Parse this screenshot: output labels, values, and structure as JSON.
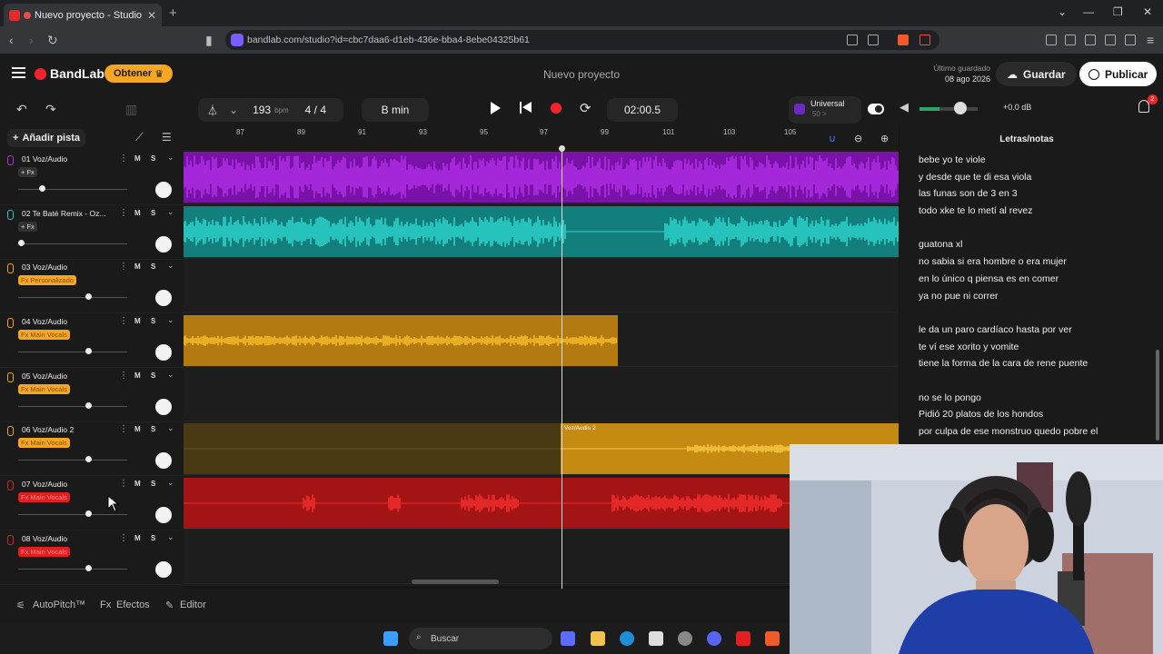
{
  "browser": {
    "tab_title": "Nuevo proyecto - Studio",
    "url": "bandlab.com/studio?id=cbc7daa6-d1eb-436e-bba4-8ebe04325b61"
  },
  "header": {
    "logo": "BandLab",
    "get_label": "Obtener",
    "project_title": "Nuevo proyecto",
    "saved_label": "Último guardado",
    "saved_date": "08 ago 2026",
    "save_label": "Guardar",
    "publish_label": "Publicar"
  },
  "transport": {
    "bpm": "193",
    "bpm_unit": "bpm",
    "time_signature": "4 / 4",
    "key": "B min",
    "time": "02:00.5",
    "preset_name": "Universal",
    "preset_sub": "50 >",
    "volume_db": "+0.0 dB",
    "volume_level": 0.6,
    "notifications": "2"
  },
  "left_panel": {
    "add_track_label": "Añadir pista"
  },
  "tracks": [
    {
      "name": "01 Voz/Audio",
      "fx": "+ Fx",
      "color": "#b32cf0",
      "fx_style": "plain",
      "volume": 0.25
    },
    {
      "name": "02 Te Baté Remix - Oz...",
      "fx": "+ Fx",
      "color": "#26c9c4",
      "fx_style": "plain",
      "volume": 0.0
    },
    {
      "name": "03 Voz/Audio",
      "fx": "Fx Personalizado",
      "color": "#f5a623",
      "fx_style": "tag",
      "volume": 0.8
    },
    {
      "name": "04 Voz/Audio",
      "fx": "Fx Main Vocals",
      "color": "#f5a623",
      "fx_style": "tag",
      "volume": 0.8
    },
    {
      "name": "05 Voz/Audio",
      "fx": "Fx Main Vocals",
      "color": "#f5a623",
      "fx_style": "tag",
      "volume": 0.8
    },
    {
      "name": "06 Voz/Audio 2",
      "fx": "Fx Main Vocals",
      "color": "#f5a623",
      "fx_style": "tag",
      "volume": 0.8
    },
    {
      "name": "07 Voz/Audio",
      "fx": "Fx Main Vocals",
      "color": "#e02020",
      "fx_style": "tag",
      "volume": 0.8
    },
    {
      "name": "08 Voz/Audio",
      "fx": "Fx Main Vocals",
      "color": "#e02020",
      "fx_style": "tag",
      "volume": 0.8
    }
  ],
  "ruler_ticks": [
    "87",
    "89",
    "91",
    "93",
    "95",
    "97",
    "99",
    "101",
    "103",
    "105"
  ],
  "clip_label": "Voz/Audio 2",
  "bottom_tabs": {
    "autopitch": "AutoPitch™",
    "effects": "Efectos",
    "editor": "Editor"
  },
  "lyrics": {
    "title": "Letras/notas",
    "lines": [
      "bebe yo te viole",
      "y desde que te di esa viola",
      "las funas son de 3 en 3",
      "todo xke te lo metí al revez",
      "",
      "guatona xl",
      "no sabia si era hombre o era mujer",
      "en lo único q piensa es en comer",
      "ya no pue ni correr",
      "",
      "le da un paro cardíaco hasta por ver",
      "te ví ese xorito y vomite",
      "tiene la forma de la cara de rene puente",
      "",
      "no se lo pongo",
      "Pidió 20 platos de los hondos",
      "por culpa de ese monstruo quedo pobre el"
    ]
  },
  "taskbar": {
    "search_placeholder": "Buscar"
  }
}
